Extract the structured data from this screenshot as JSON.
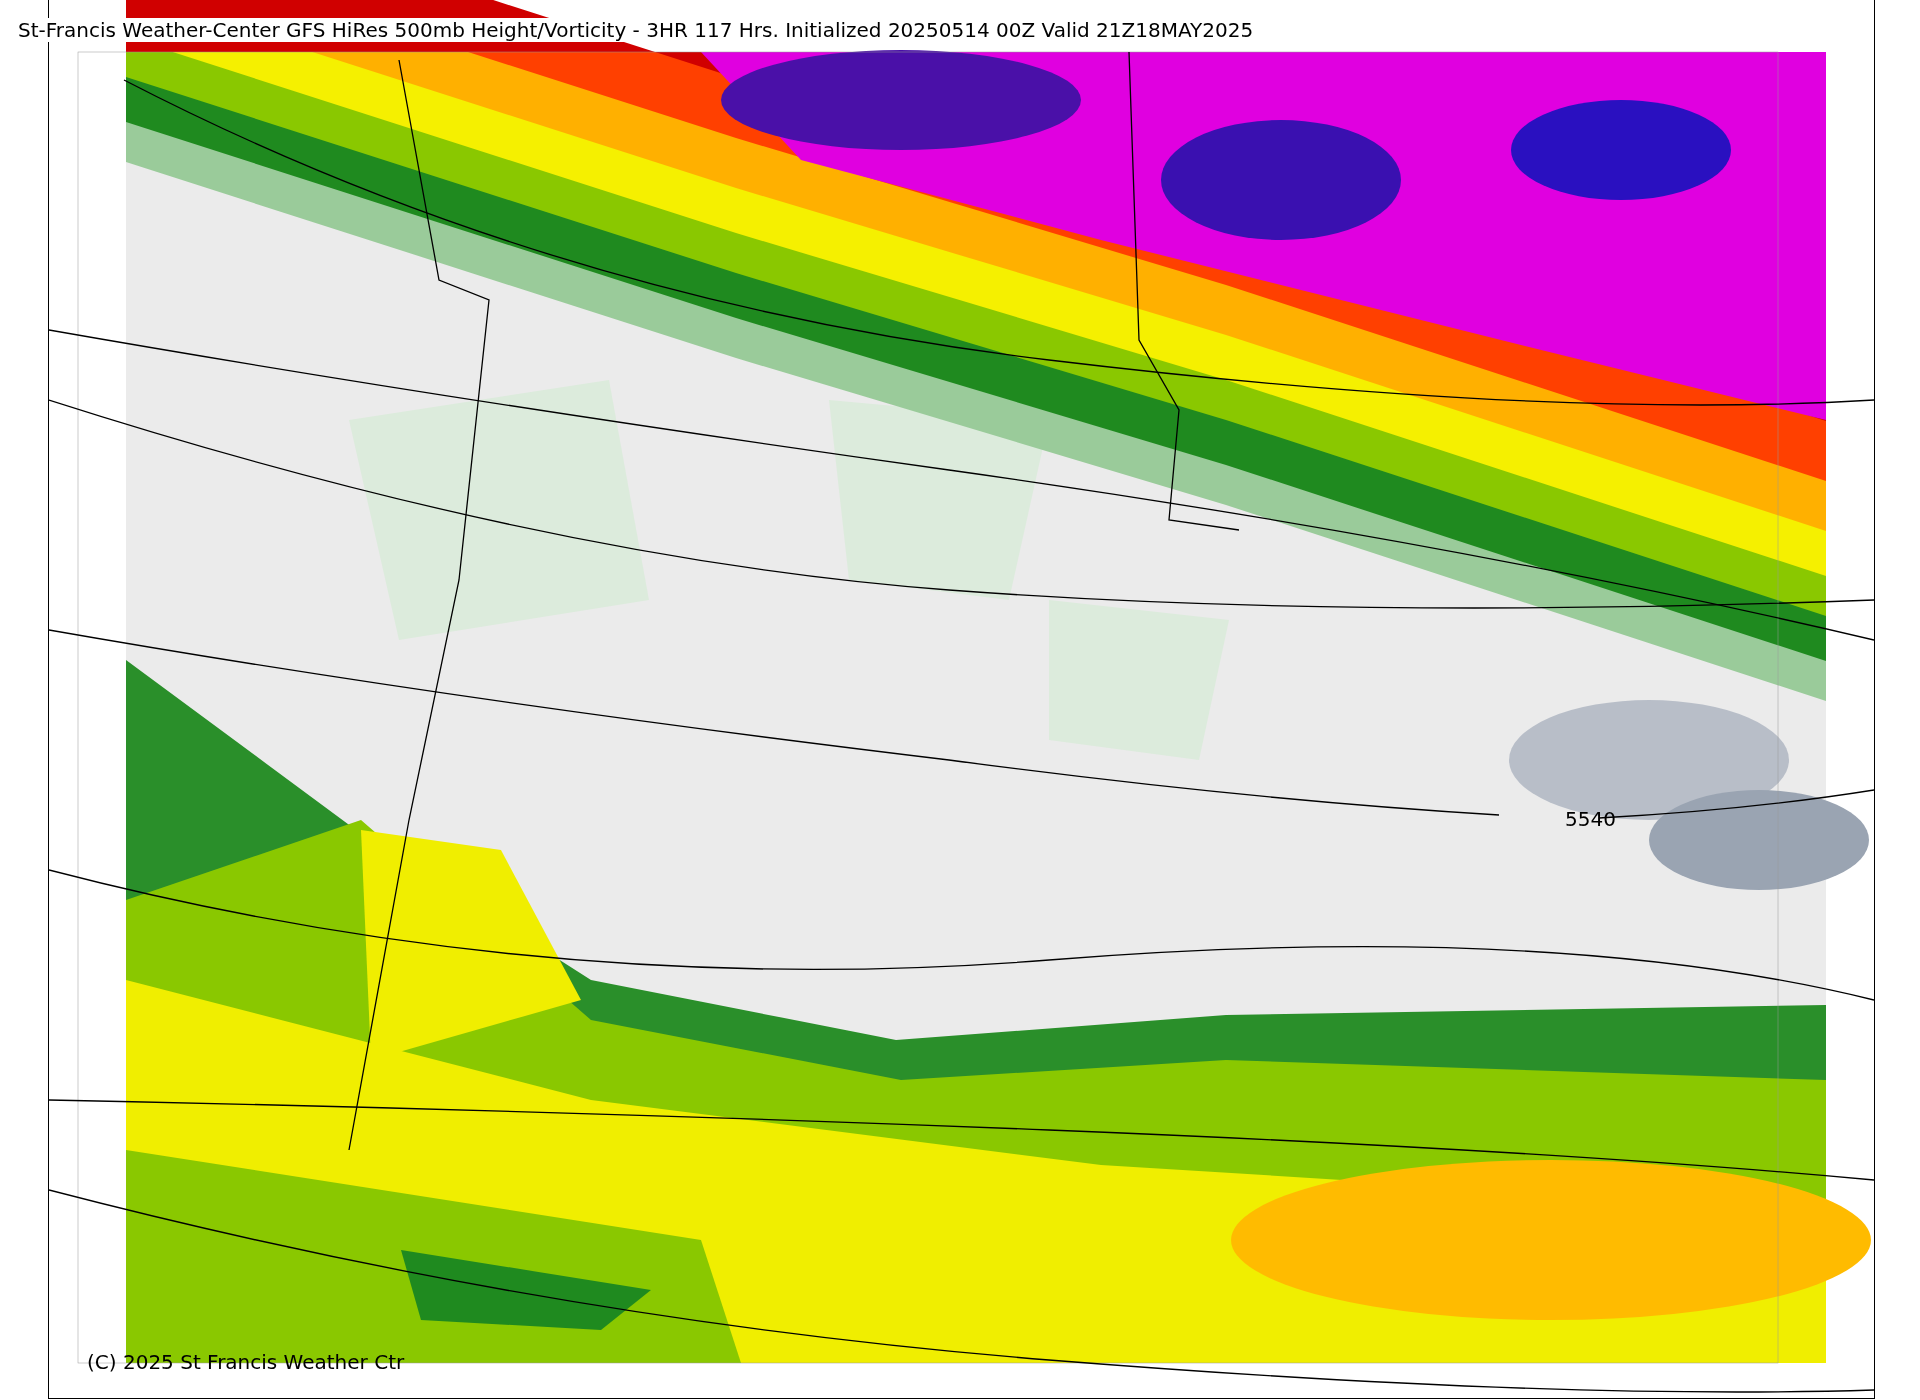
{
  "title": "St-Francis Weather-Center GFS HiRes 500mb Height/Vorticity - 3HR  117 Hrs.  Initialized 20250514 00Z Valid 21Z18MAY2025",
  "contour_label": "5540",
  "copyright": "(C) 2025 St Francis Weather Ctr"
}
